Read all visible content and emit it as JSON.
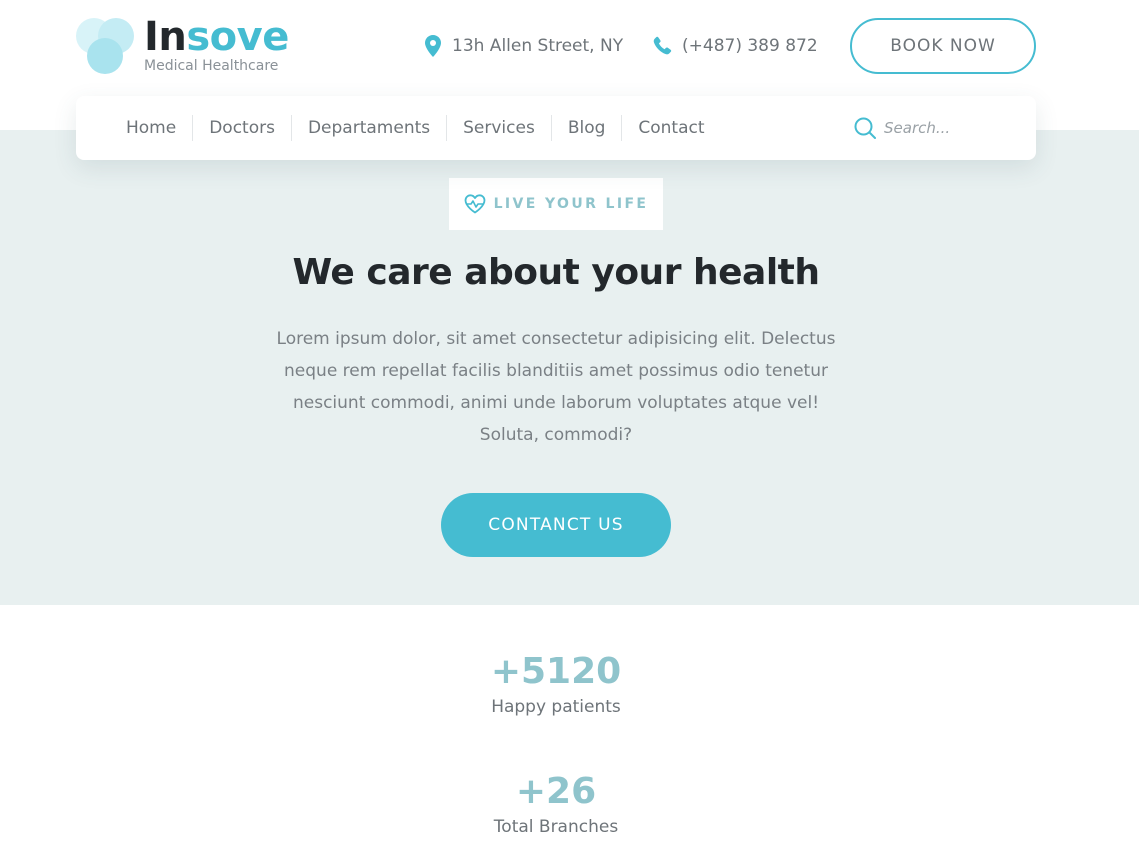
{
  "brand": {
    "name_dark": "In",
    "name_accent": "sove",
    "tagline": "Medical Healthcare",
    "colors": {
      "accent": "#45bcd1",
      "dark": "#23282c",
      "muted": "#8fc4cc",
      "hero_bg": "#e8f0f0"
    }
  },
  "header": {
    "address": "13h Allen Street, NY",
    "address_icon": "map-pin-icon",
    "phone": "(+487) 389 872",
    "phone_icon": "phone-icon",
    "book_label": "BOOK NOW"
  },
  "nav": {
    "items": [
      {
        "label": "Home"
      },
      {
        "label": "Doctors"
      },
      {
        "label": "Departaments"
      },
      {
        "label": "Services"
      },
      {
        "label": "Blog"
      },
      {
        "label": "Contact"
      }
    ],
    "search_placeholder": "Search...",
    "search_icon": "search-icon"
  },
  "hero": {
    "badge_icon": "heart-pulse-icon",
    "badge": "LIVE YOUR LIFE",
    "title": "We care about your health",
    "text": "Lorem ipsum dolor, sit amet consectetur adipisicing elit. Delectus neque rem repellat facilis blanditiis amet possimus odio tenetur nesciunt commodi, animi unde laborum voluptates atque vel! Soluta, commodi?",
    "cta": "CONTANCT US"
  },
  "stats": [
    {
      "value": "+5120",
      "label": "Happy patients"
    },
    {
      "value": "+26",
      "label": "Total Branches"
    }
  ]
}
